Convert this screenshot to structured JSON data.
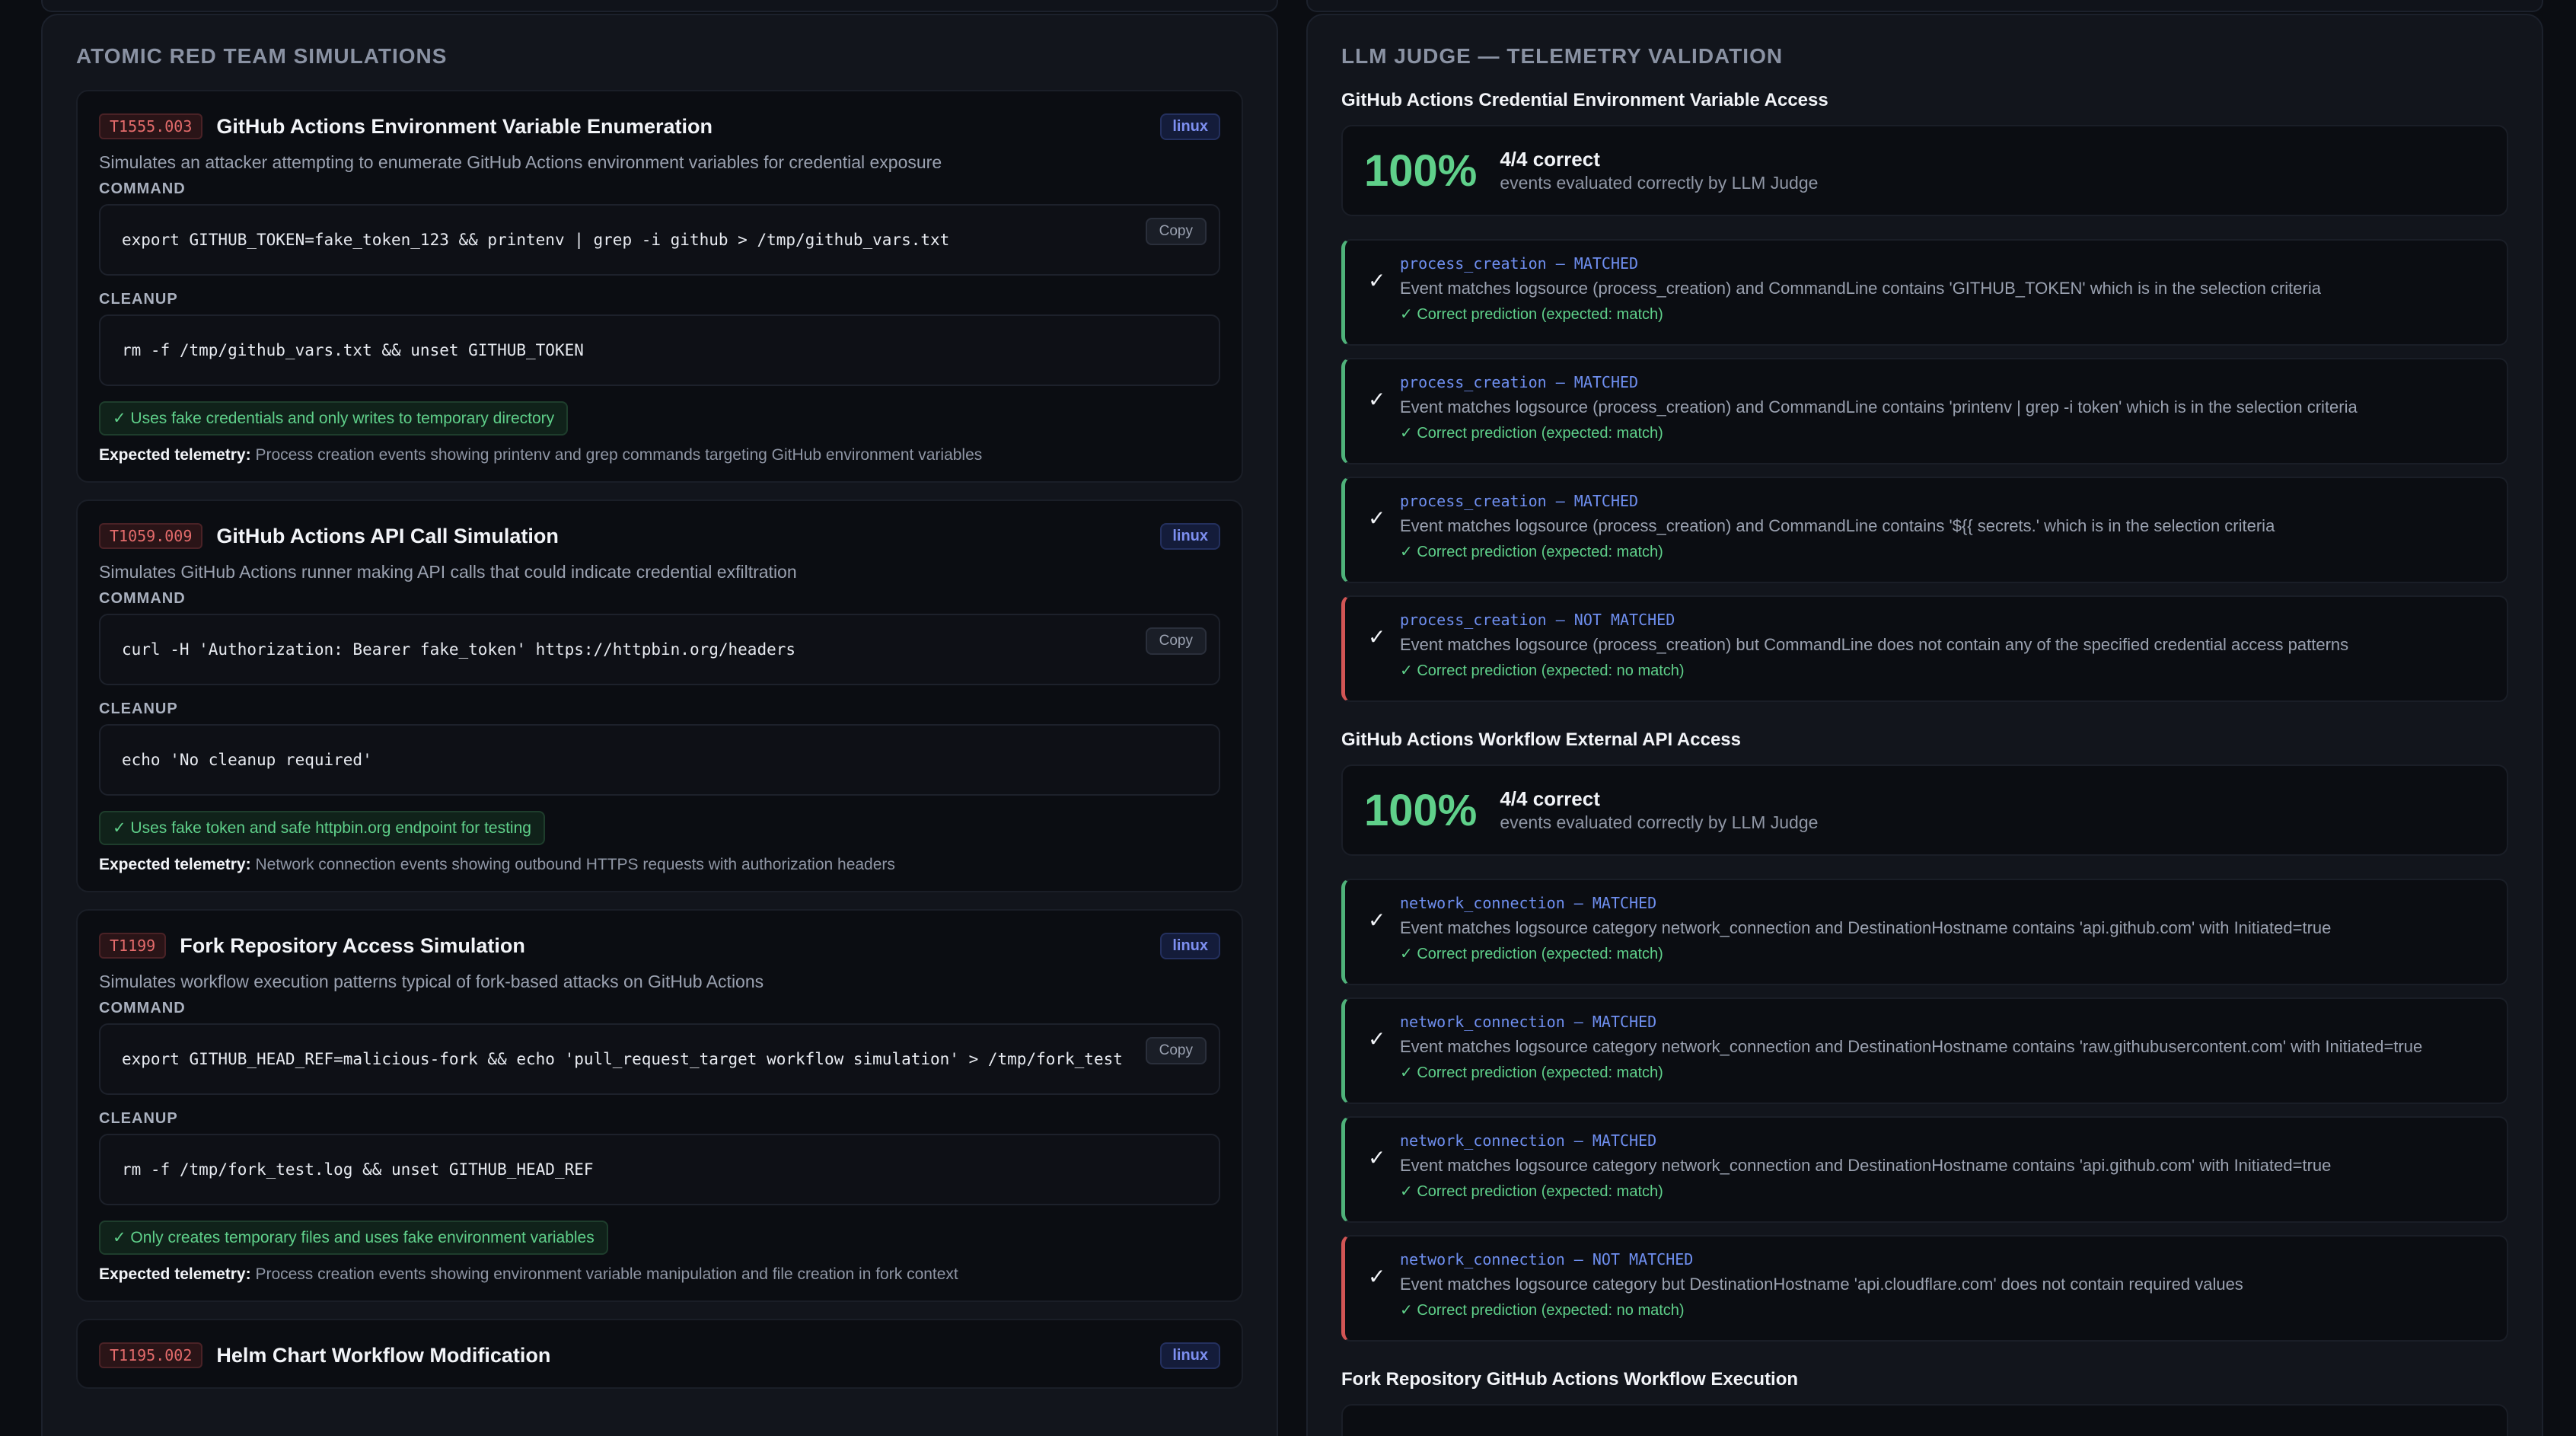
{
  "left_panel": {
    "title": "ATOMIC RED TEAM SIMULATIONS",
    "labels": {
      "command": "COMMAND",
      "cleanup": "CLEANUP",
      "copy": "Copy",
      "expected": "Expected telemetry:"
    },
    "simulations": [
      {
        "technique_id": "T1555.003",
        "name": "GitHub Actions Environment Variable Enumeration",
        "platform": "linux",
        "description": "Simulates an attacker attempting to enumerate GitHub Actions environment variables for credential exposure",
        "command": "export GITHUB_TOKEN=fake_token_123 && printenv | grep -i github > /tmp/github_vars.txt",
        "cleanup": "rm -f /tmp/github_vars.txt && unset GITHUB_TOKEN",
        "safety": "✓ Uses fake credentials and only writes to temporary directory",
        "telemetry": "Process creation events showing printenv and grep commands targeting GitHub environment variables"
      },
      {
        "technique_id": "T1059.009",
        "name": "GitHub Actions API Call Simulation",
        "platform": "linux",
        "description": "Simulates GitHub Actions runner making API calls that could indicate credential exfiltration",
        "command": "curl -H 'Authorization: Bearer fake_token' https://httpbin.org/headers",
        "cleanup": "echo 'No cleanup required'",
        "safety": "✓ Uses fake token and safe httpbin.org endpoint for testing",
        "telemetry": "Network connection events showing outbound HTTPS requests with authorization headers"
      },
      {
        "technique_id": "T1199",
        "name": "Fork Repository Access Simulation",
        "platform": "linux",
        "description": "Simulates workflow execution patterns typical of fork-based attacks on GitHub Actions",
        "command": "export GITHUB_HEAD_REF=malicious-fork && echo 'pull_request_target workflow simulation' > /tmp/fork_test",
        "cleanup": "rm -f /tmp/fork_test.log && unset GITHUB_HEAD_REF",
        "safety": "✓ Only creates temporary files and uses fake environment variables",
        "telemetry": "Process creation events showing environment variable manipulation and file creation in fork context"
      },
      {
        "technique_id": "T1195.002",
        "name": "Helm Chart Workflow Modification",
        "platform": "linux"
      }
    ]
  },
  "right_panel": {
    "title": "LLM JUDGE — TELEMETRY VALIDATION",
    "rules": [
      {
        "title": "GitHub Actions Credential Environment Variable Access",
        "score_pct": "100%",
        "score_main": "4/4 correct",
        "score_sub": "events evaluated correctly by LLM Judge",
        "events": [
          {
            "header": "process_creation — MATCHED",
            "text": "Event matches logsource (process_creation) and CommandLine contains 'GITHUB_TOKEN' which is in the selection criteria",
            "prediction": "✓ Correct prediction (expected: match)"
          },
          {
            "header": "process_creation — MATCHED",
            "text": "Event matches logsource (process_creation) and CommandLine contains 'printenv | grep -i token' which is in the selection criteria",
            "prediction": "✓ Correct prediction (expected: match)"
          },
          {
            "header": "process_creation — MATCHED",
            "text": "Event matches logsource (process_creation) and CommandLine contains '${{ secrets.' which is in the selection criteria",
            "prediction": "✓ Correct prediction (expected: match)"
          },
          {
            "header": "process_creation — NOT MATCHED",
            "text": "Event matches logsource (process_creation) but CommandLine does not contain any of the specified credential access patterns",
            "prediction": "✓ Correct prediction (expected: no match)"
          }
        ]
      },
      {
        "title": "GitHub Actions Workflow External API Access",
        "score_pct": "100%",
        "score_main": "4/4 correct",
        "score_sub": "events evaluated correctly by LLM Judge",
        "events": [
          {
            "header": "network_connection — MATCHED",
            "text": "Event matches logsource category network_connection and DestinationHostname contains 'api.github.com' with Initiated=true",
            "prediction": "✓ Correct prediction (expected: match)"
          },
          {
            "header": "network_connection — MATCHED",
            "text": "Event matches logsource category network_connection and DestinationHostname contains 'raw.githubusercontent.com' with Initiated=true",
            "prediction": "✓ Correct prediction (expected: match)"
          },
          {
            "header": "network_connection — MATCHED",
            "text": "Event matches logsource category network_connection and DestinationHostname contains 'api.github.com' with Initiated=true",
            "prediction": "✓ Correct prediction (expected: match)"
          },
          {
            "header": "network_connection — NOT MATCHED",
            "text": "Event matches logsource category but DestinationHostname 'api.cloudflare.com' does not contain required values",
            "prediction": "✓ Correct prediction (expected: no match)"
          }
        ]
      },
      {
        "title": "Fork Repository GitHub Actions Workflow Execution"
      }
    ],
    "check_glyph": "✓"
  }
}
